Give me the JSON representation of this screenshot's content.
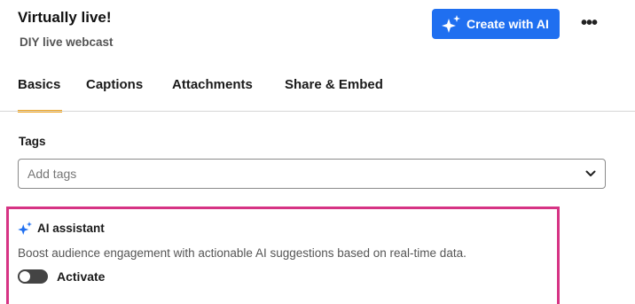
{
  "header": {
    "title": "Virtually live!",
    "subtitle": "DIY live webcast",
    "create_ai_label": "Create with AI",
    "more_label": "•••"
  },
  "tabs": [
    {
      "label": "Basics",
      "active": true
    },
    {
      "label": "Captions"
    },
    {
      "label": "Attachments"
    },
    {
      "label": "Share & Embed"
    }
  ],
  "tags": {
    "label": "Tags",
    "placeholder": "Add tags"
  },
  "ai_assistant": {
    "title": "AI assistant",
    "description": "Boost audience engagement with actionable AI suggestions based on real-time data.",
    "toggle_label": "Activate",
    "toggle_on": false
  },
  "colors": {
    "accent_blue": "#1f6ff0",
    "tab_indicator": "#f2a51c",
    "highlight_border": "#d63384"
  },
  "icons": [
    "sparkle-icon",
    "more-dots-icon",
    "chevron-down-icon"
  ]
}
